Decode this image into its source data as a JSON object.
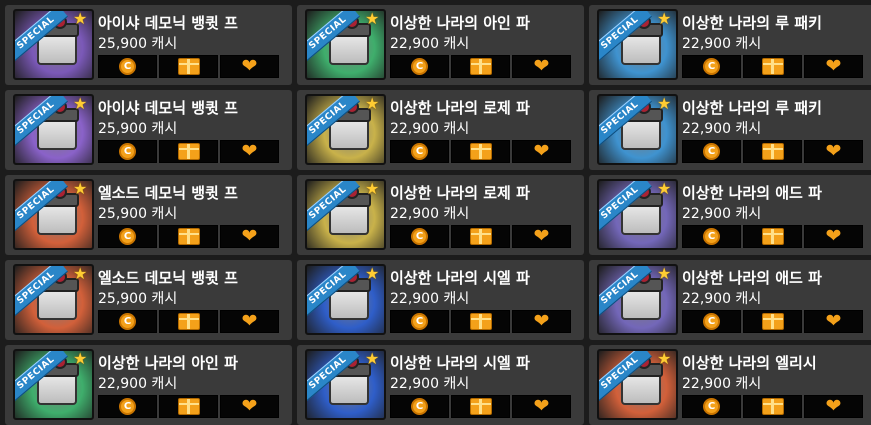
{
  "ribbon_label": "SPECIAL",
  "items": [
    {
      "name": "아이샤 데모닉 뱅큇 프",
      "price": "25,900 캐시",
      "bg": "#7b59b8"
    },
    {
      "name": "이상한 나라의 아인 파",
      "price": "22,900 캐시",
      "bg": "#3fae6c"
    },
    {
      "name": "이상한 나라의 루 패키",
      "price": "22,900 캐시",
      "bg": "#3f93d0"
    },
    {
      "name": "아이샤 데모닉 뱅큇 프",
      "price": "25,900 캐시",
      "bg": "#8a62c9"
    },
    {
      "name": "이상한 나라의 로제 파",
      "price": "22,900 캐시",
      "bg": "#c9b24a"
    },
    {
      "name": "이상한 나라의 루 패키",
      "price": "22,900 캐시",
      "bg": "#3f93d0"
    },
    {
      "name": "엘소드 데모닉 뱅큇 프",
      "price": "25,900 캐시",
      "bg": "#d2603a"
    },
    {
      "name": "이상한 나라의 로제 파",
      "price": "22,900 캐시",
      "bg": "#c9b24a"
    },
    {
      "name": "이상한 나라의 애드 파",
      "price": "22,900 캐시",
      "bg": "#7367b9"
    },
    {
      "name": "엘소드 데모닉 뱅큇 프",
      "price": "25,900 캐시",
      "bg": "#d2603a"
    },
    {
      "name": "이상한 나라의 시엘 파",
      "price": "22,900 캐시",
      "bg": "#2f5ec9"
    },
    {
      "name": "이상한 나라의 애드 파",
      "price": "22,900 캐시",
      "bg": "#7367b9"
    },
    {
      "name": "이상한 나라의 아인 파",
      "price": "22,900 캐시",
      "bg": "#3fae6c"
    },
    {
      "name": "이상한 나라의 시엘 파",
      "price": "22,900 캐시",
      "bg": "#2f5ec9"
    },
    {
      "name": "이상한 나라의 엘리시",
      "price": "22,900 캐시",
      "bg": "#d2603a"
    }
  ],
  "button_icons": [
    "cash-coin-icon",
    "gift-box-icon",
    "heart-icon"
  ],
  "colors": {
    "card": "#3a3a3a",
    "button": "#050505",
    "accent": "#f4a11a",
    "ribbon": "#2a86c8"
  }
}
